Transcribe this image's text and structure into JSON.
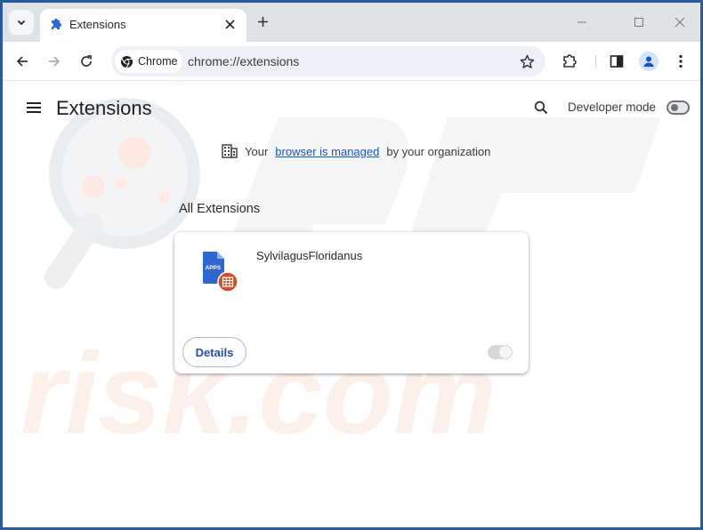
{
  "browser": {
    "tab": {
      "title": "Extensions",
      "favicon": "puzzle-icon"
    },
    "new_tab_label": "+",
    "window_controls": [
      "minimize",
      "maximize",
      "close"
    ],
    "omnibox": {
      "chip_label": "Chrome",
      "url": "chrome://extensions"
    },
    "toolbar_icons": [
      "back-icon",
      "forward-icon",
      "reload-icon",
      "bookmark-star-icon",
      "extensions-icon",
      "side-panel-icon",
      "profile-icon",
      "menu-icon"
    ]
  },
  "page": {
    "title": "Extensions",
    "developer_mode": {
      "label": "Developer mode",
      "enabled": false
    },
    "managed_notice": {
      "prefix": "Your",
      "link": "browser is managed",
      "suffix": "by your organization"
    },
    "section_title": "All Extensions",
    "extensions": [
      {
        "name": "SylvilagusFloridanus",
        "icon_text": "APPS",
        "details_label": "Details",
        "enabled": true
      }
    ]
  },
  "colors": {
    "accent": "#1a56c4",
    "frame": "#2c5a9e",
    "tabstrip": "#dfe3e8",
    "badge": "#c8502a",
    "doc_blue": "#2f66d0"
  }
}
